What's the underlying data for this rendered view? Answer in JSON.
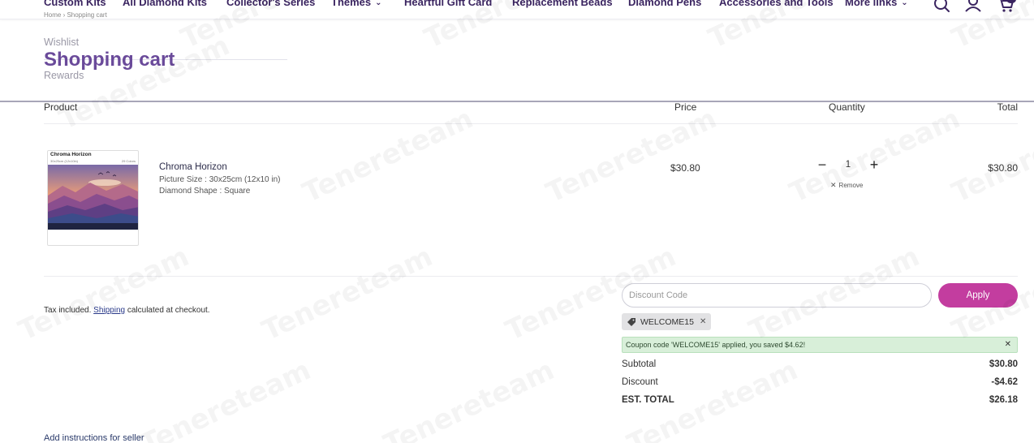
{
  "nav": {
    "items": [
      "Custom Kits",
      "All Diamond Kits",
      "Collector's Series",
      "Themes",
      "Heartful Gift Card",
      "Replacement Beads",
      "Diamond Pens",
      "Accessories and Tools",
      "More links"
    ],
    "icons": [
      "search-icon",
      "account-icon",
      "cart-icon"
    ]
  },
  "breadcrumb": "Home  ›  Shopping cart",
  "header_menu": {
    "wishlist": "Wishlist",
    "title": "Shopping cart",
    "rewards": "Rewards"
  },
  "table": {
    "headers": [
      "Product",
      "Price",
      "Quantity",
      "Total"
    ]
  },
  "item": {
    "name": "Chroma Horizon",
    "picture_size": "Picture Size : 30x25cm (12x10 in)",
    "diamond_shape": "Diamond Shape : Square",
    "thumb_title": "Chroma Horizon",
    "thumb_size": "30x25cm (12x10in)",
    "thumb_colors": "29 Colors",
    "price": "$30.80",
    "quantity": "1",
    "minus": "−",
    "plus": "+",
    "remove": "Remove",
    "total": "$30.80"
  },
  "tax_note": {
    "before": "Tax included. ",
    "link": "Shipping",
    "after": " calculated at checkout."
  },
  "discount": {
    "placeholder": "Discount Code",
    "apply": "Apply",
    "coupon_code": "WELCOME15",
    "success_message": "Coupon code 'WELCOME15' applied, you saved $4.62!"
  },
  "summary": {
    "subtotal_label": "Subtotal",
    "subtotal_value": "$30.80",
    "discount_label": "Discount",
    "discount_value": "-$4.62",
    "total_label": "EST. TOTAL",
    "total_value": "$26.18"
  },
  "instructions": "Add instructions for seller",
  "watermark_text": "Tenereteam",
  "colors": {
    "brand": "#3a2460",
    "title": "#6a4a9a",
    "apply_button": "#c33d9f",
    "success_bg": "#d8efd9"
  }
}
